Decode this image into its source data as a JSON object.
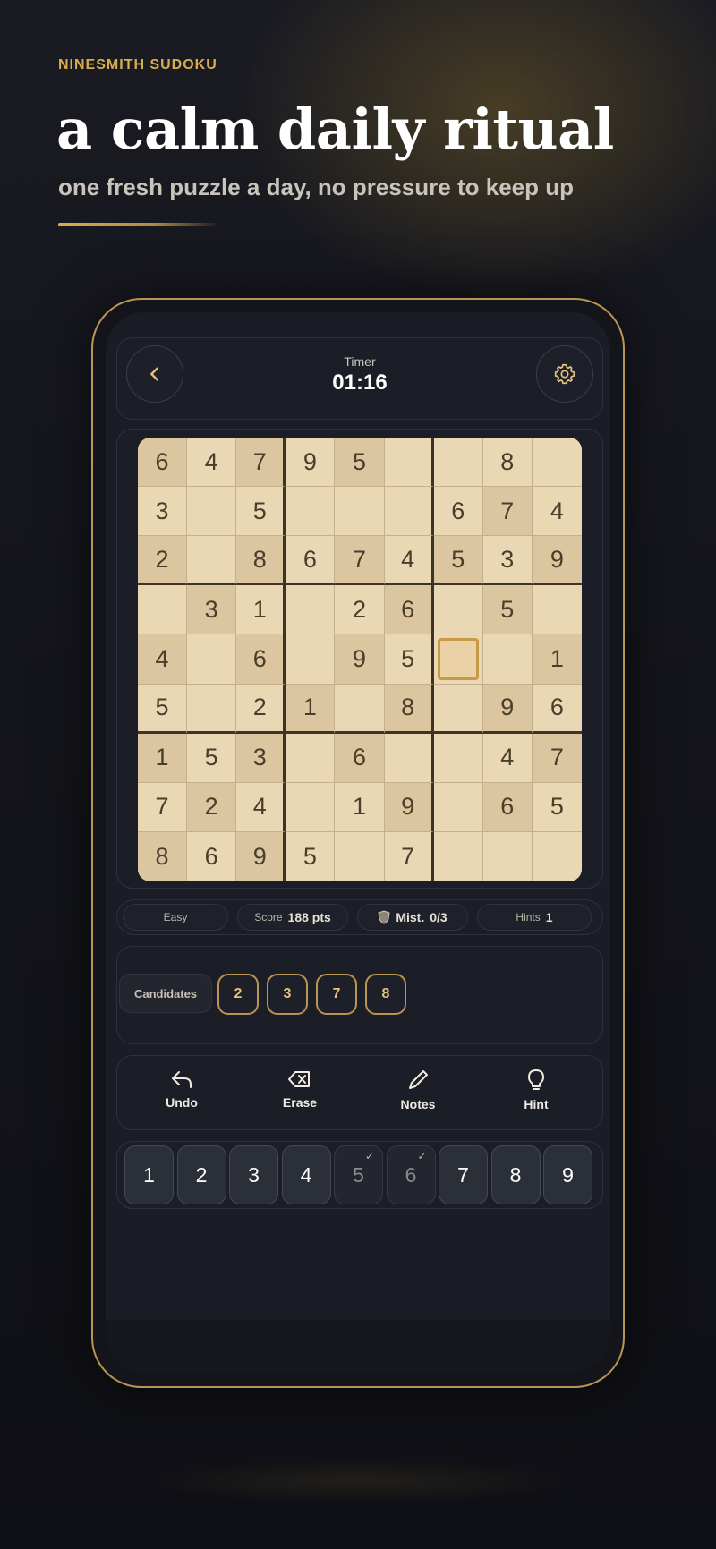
{
  "hero": {
    "brand": "NINESMITH SUDOKU",
    "headline": "a calm daily ritual",
    "subline": "one fresh puzzle a day, no pressure to keep up"
  },
  "colors": {
    "accent_gold": "#d8ad4e",
    "board_cell": "#ead8b4",
    "board_cell_shaded": "#dcc6a0",
    "card_bg": "#1b1e26"
  },
  "topbar": {
    "back_icon": "chevron-left-icon",
    "timer_label": "Timer",
    "timer_value": "01:16",
    "settings_icon": "gear-icon"
  },
  "board": {
    "grid": [
      [
        "6",
        "4",
        "7",
        "9",
        "5",
        "",
        "",
        "8",
        ""
      ],
      [
        "3",
        "",
        "5",
        "",
        "",
        "",
        "6",
        "7",
        "4"
      ],
      [
        "2",
        "",
        "8",
        "6",
        "7",
        "4",
        "5",
        "3",
        "9"
      ],
      [
        "",
        "3",
        "1",
        "",
        "2",
        "6",
        "",
        "5",
        ""
      ],
      [
        "4",
        "",
        "6",
        "",
        "9",
        "5",
        "",
        "",
        "1"
      ],
      [
        "5",
        "",
        "2",
        "1",
        "",
        "8",
        "",
        "9",
        "6"
      ],
      [
        "1",
        "5",
        "3",
        "",
        "6",
        "",
        "",
        "4",
        "7"
      ],
      [
        "7",
        "2",
        "4",
        "",
        "1",
        "9",
        "",
        "6",
        "5"
      ],
      [
        "8",
        "6",
        "9",
        "5",
        "",
        "7",
        "",
        "",
        ""
      ]
    ],
    "selected_row": 4,
    "selected_col": 6
  },
  "stats": {
    "difficulty": "Easy",
    "score_label": "Score",
    "score_value": "188 pts",
    "mistakes_label": "Mist.",
    "mistakes_value": "0/3",
    "hints_label": "Hints",
    "hints_value": "1"
  },
  "candidates": {
    "label": "Candidates",
    "values": [
      "2",
      "3",
      "7",
      "8"
    ]
  },
  "actions": [
    {
      "label": "Undo",
      "icon": "undo-icon"
    },
    {
      "label": "Erase",
      "icon": "erase-icon"
    },
    {
      "label": "Notes",
      "icon": "pencil-icon"
    },
    {
      "label": "Hint",
      "icon": "lightbulb-icon"
    }
  ],
  "keypad": {
    "keys": [
      "1",
      "2",
      "3",
      "4",
      "5",
      "6",
      "7",
      "8",
      "9"
    ],
    "completed": [
      "5",
      "6"
    ]
  }
}
